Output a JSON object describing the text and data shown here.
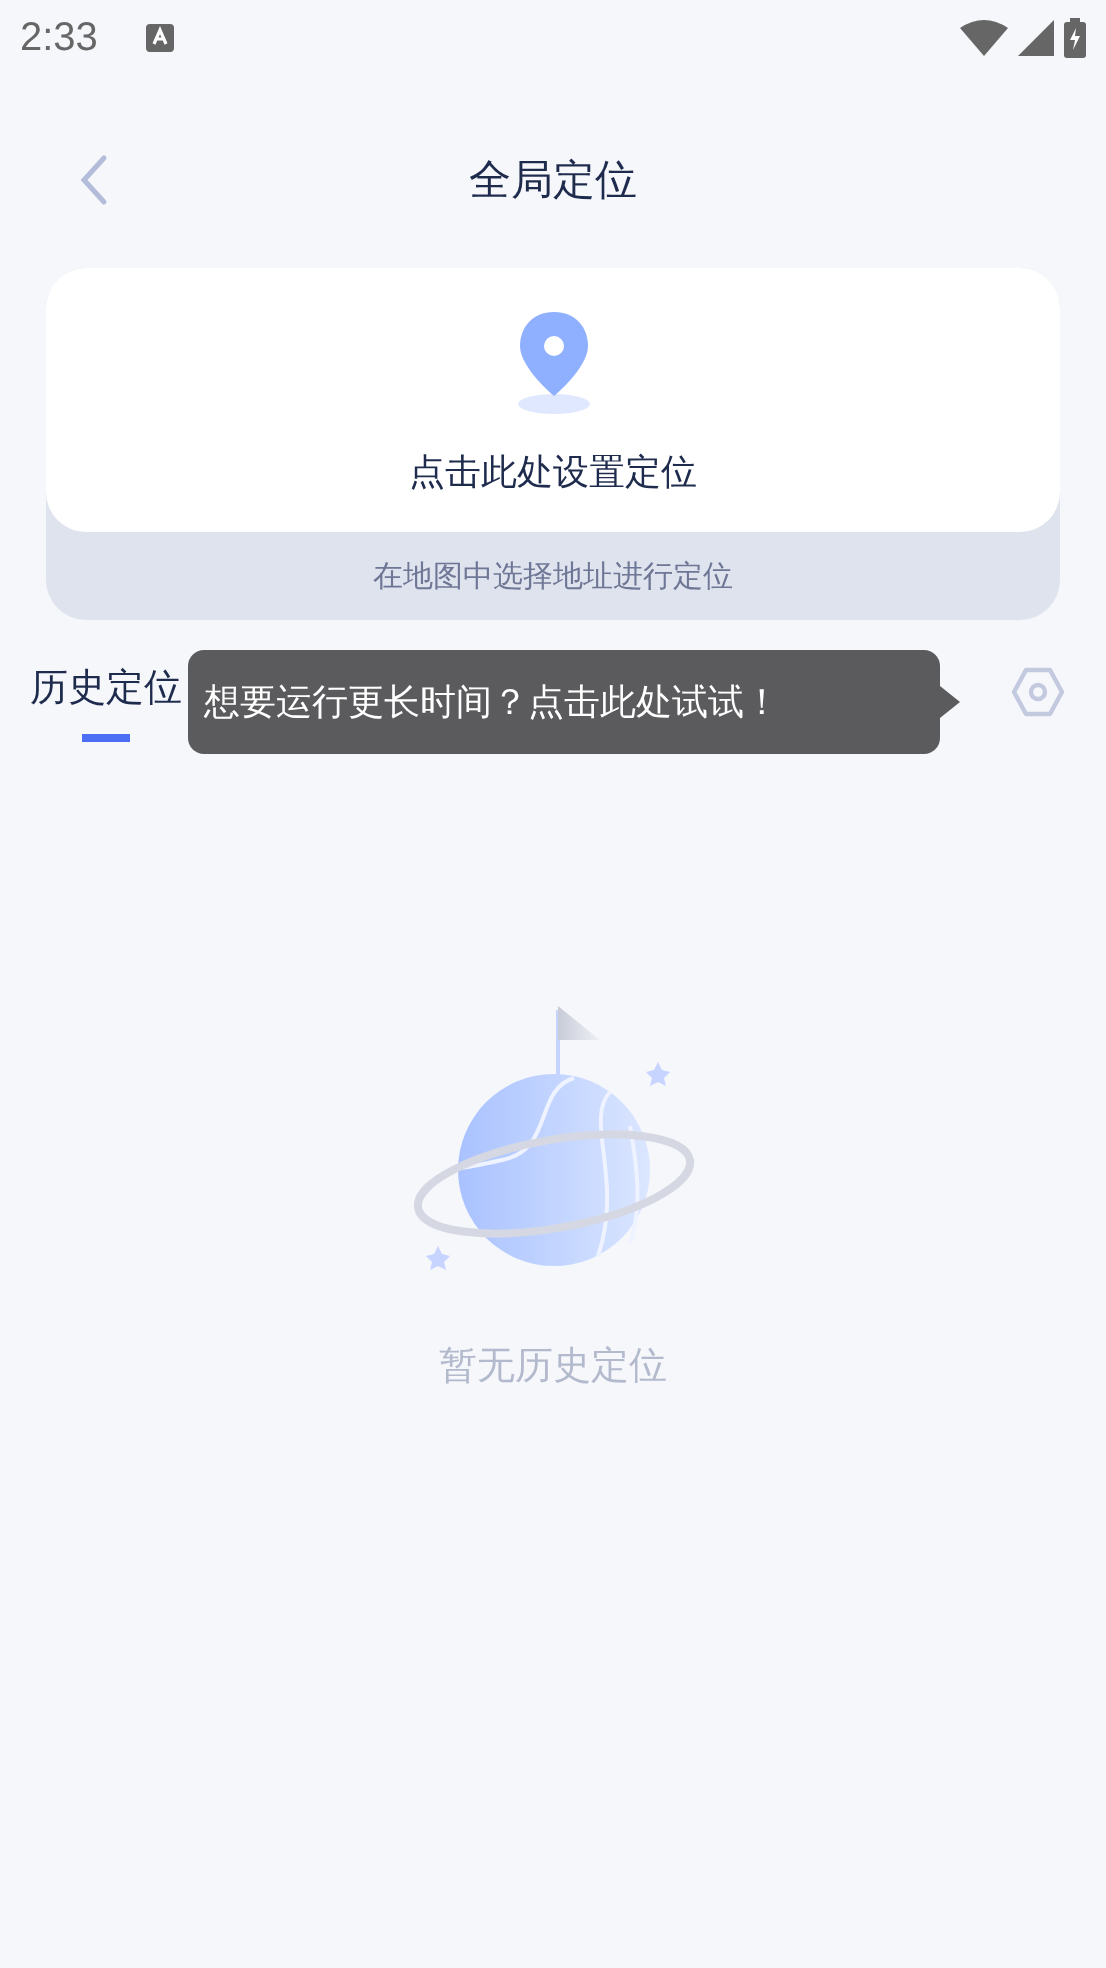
{
  "status_bar": {
    "time": "2:33"
  },
  "header": {
    "title": "全局定位"
  },
  "location_card": {
    "action": "点击此处设置定位",
    "hint": "在地图中选择地址进行定位"
  },
  "tabs": [
    {
      "label": "历史定位",
      "selected": true
    }
  ],
  "tooltip": {
    "text": "想要运行更长时间？点击此处试试！"
  },
  "empty_state": {
    "message": "暂无历史定位"
  }
}
